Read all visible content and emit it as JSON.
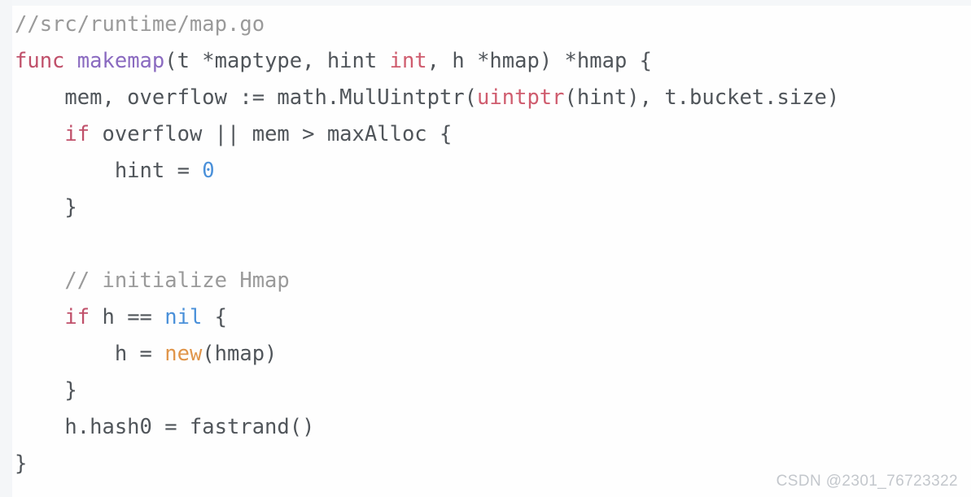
{
  "code_block": {
    "language": "go",
    "background_color": "#fefefe",
    "default_text_color": "#50555a",
    "gutter_color": "#f4f6f8",
    "theme_colors": {
      "comment": "#9a9a9a",
      "keyword": "#c0506a",
      "function": "#8a6ac0",
      "type": "#cf5c6e",
      "builtin": "#e0954a",
      "number": "#4a90d9",
      "constant": "#4a90d9",
      "plain": "#50555a"
    },
    "lines": [
      {
        "index": 1,
        "text": "//src/runtime/map.go",
        "tokens": [
          {
            "t": "//src/runtime/map.go",
            "c": "comment"
          }
        ]
      },
      {
        "index": 2,
        "text": "func makemap(t *maptype, hint int, h *hmap) *hmap {",
        "tokens": [
          {
            "t": "func",
            "c": "keyword"
          },
          {
            "t": " ",
            "c": "plain"
          },
          {
            "t": "makemap",
            "c": "function"
          },
          {
            "t": "(t *maptype, hint ",
            "c": "plain"
          },
          {
            "t": "int",
            "c": "type"
          },
          {
            "t": ", h *hmap) *hmap {",
            "c": "plain"
          }
        ]
      },
      {
        "index": 3,
        "text": "    mem, overflow := math.MulUintptr(uintptr(hint), t.bucket.size)",
        "tokens": [
          {
            "t": "    mem, overflow := math.MulUintptr(",
            "c": "plain"
          },
          {
            "t": "uintptr",
            "c": "type"
          },
          {
            "t": "(hint), t.bucket.size)",
            "c": "plain"
          }
        ]
      },
      {
        "index": 4,
        "text": "    if overflow || mem > maxAlloc {",
        "tokens": [
          {
            "t": "    ",
            "c": "plain"
          },
          {
            "t": "if",
            "c": "keyword"
          },
          {
            "t": " overflow || mem > maxAlloc {",
            "c": "plain"
          }
        ]
      },
      {
        "index": 5,
        "text": "        hint = 0",
        "tokens": [
          {
            "t": "        hint = ",
            "c": "plain"
          },
          {
            "t": "0",
            "c": "number"
          }
        ]
      },
      {
        "index": 6,
        "text": "    }",
        "tokens": [
          {
            "t": "    }",
            "c": "plain"
          }
        ]
      },
      {
        "index": 7,
        "text": "",
        "tokens": []
      },
      {
        "index": 8,
        "text": "    // initialize Hmap",
        "tokens": [
          {
            "t": "    ",
            "c": "plain"
          },
          {
            "t": "// initialize Hmap",
            "c": "comment"
          }
        ]
      },
      {
        "index": 9,
        "text": "    if h == nil {",
        "tokens": [
          {
            "t": "    ",
            "c": "plain"
          },
          {
            "t": "if",
            "c": "keyword"
          },
          {
            "t": " h == ",
            "c": "plain"
          },
          {
            "t": "nil",
            "c": "constant"
          },
          {
            "t": " {",
            "c": "plain"
          }
        ]
      },
      {
        "index": 10,
        "text": "        h = new(hmap)",
        "tokens": [
          {
            "t": "        h = ",
            "c": "plain"
          },
          {
            "t": "new",
            "c": "builtin"
          },
          {
            "t": "(hmap)",
            "c": "plain"
          }
        ]
      },
      {
        "index": 11,
        "text": "    }",
        "tokens": [
          {
            "t": "    }",
            "c": "plain"
          }
        ]
      },
      {
        "index": 12,
        "text": "    h.hash0 = fastrand()",
        "tokens": [
          {
            "t": "    h.hash0 = fastrand()",
            "c": "plain"
          }
        ]
      },
      {
        "index": 13,
        "text": "}",
        "tokens": [
          {
            "t": "}",
            "c": "plain"
          }
        ]
      }
    ]
  },
  "watermark": {
    "text": "CSDN @2301_76723322",
    "color": "#c3c7cc"
  }
}
